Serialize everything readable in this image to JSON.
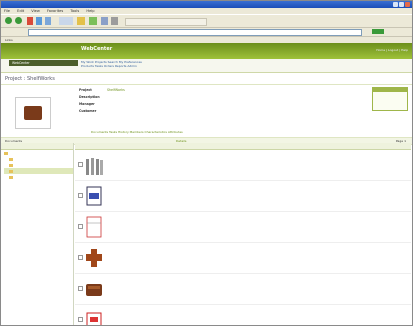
{
  "browser": {
    "title": "",
    "menu": [
      "File",
      "Edit",
      "View",
      "Favorites",
      "Tools",
      "Help"
    ],
    "address": "",
    "links": "Links"
  },
  "app": {
    "logo": "WebCenter",
    "banner_left": "",
    "banner_right": "Home | Logout | Help"
  },
  "nav": {
    "box": "WebCenter",
    "line1": "My Work   Projects   Search   My Preferences",
    "line2": "Products   Tasks   Orders   Reports   Admin"
  },
  "breadcrumb": "Project : ShelfWorks",
  "properties": {
    "rows": [
      {
        "label": "Project",
        "value": "ShelfWorks"
      },
      {
        "label": "Description",
        "value": ""
      },
      {
        "label": "Manager",
        "value": ""
      },
      {
        "label": "Customer",
        "value": ""
      }
    ],
    "related": "Documents   Tasks   History   Members   Characteristics   Attributes",
    "sidebox": {
      "header": "",
      "links": [
        "",
        "",
        ""
      ]
    }
  },
  "tabs": {
    "left": "Documents",
    "middle": "Details",
    "right": "Page 1"
  },
  "tree": {
    "header": "",
    "items": [
      {
        "label": "",
        "depth": 0,
        "selected": false
      },
      {
        "label": "",
        "depth": 1,
        "selected": false
      },
      {
        "label": "",
        "depth": 1,
        "selected": false
      },
      {
        "label": "",
        "depth": 1,
        "selected": true
      },
      {
        "label": "",
        "depth": 1,
        "selected": false
      }
    ]
  },
  "table": {
    "columns": [
      "",
      "",
      "",
      "",
      ""
    ],
    "rows": [
      {
        "name": "",
        "type": "",
        "version": "",
        "rev": "",
        "thumb": "bottles"
      },
      {
        "name": "",
        "type": "",
        "version": "",
        "rev": "",
        "thumb": "box"
      },
      {
        "name": "",
        "type": "",
        "version": "",
        "rev": "",
        "thumb": "dieline"
      },
      {
        "name": "",
        "type": "",
        "version": "",
        "rev": "",
        "thumb": "flat"
      },
      {
        "name": "",
        "type": "",
        "version": "",
        "rev": "",
        "thumb": "display"
      },
      {
        "name": "",
        "type": "",
        "version": "",
        "rev": "",
        "thumb": "label"
      }
    ]
  },
  "colors": {
    "accent_green": "#9fb64a",
    "link_green": "#6b8f17",
    "banner_dark": "#6c8f1b"
  }
}
